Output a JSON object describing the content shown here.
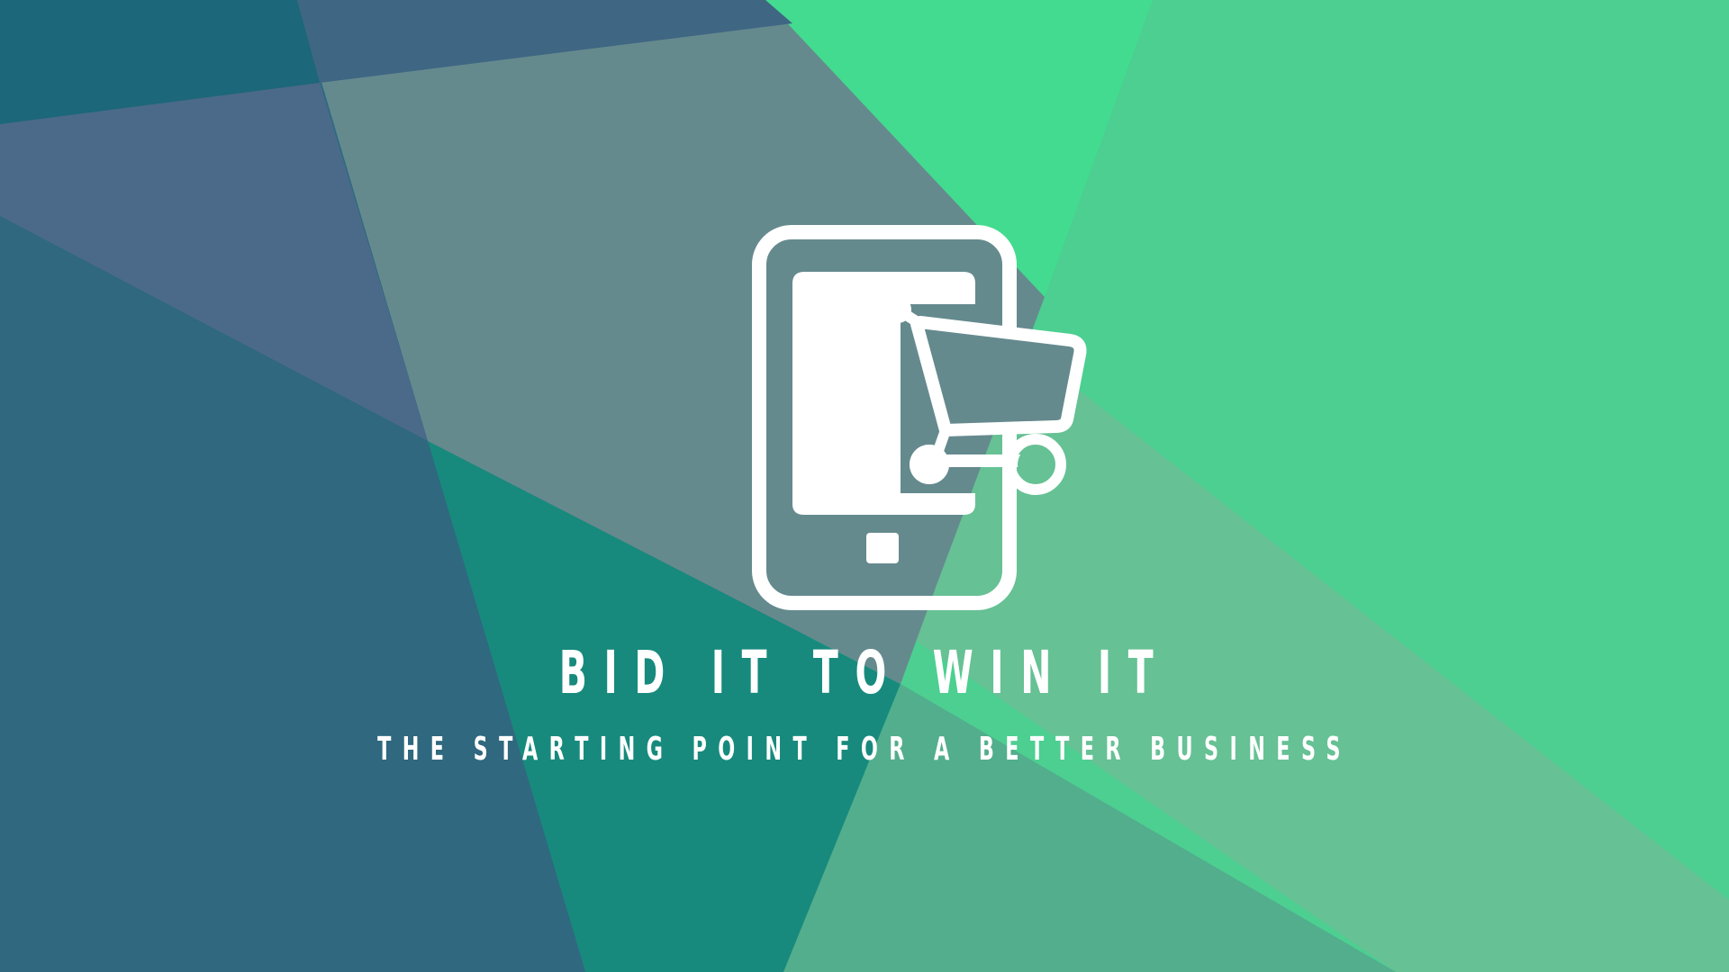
{
  "brand": {
    "title": "BID IT TO WIN IT",
    "tagline": "THE STARTING POINT FOR A BETTER BUSINESS",
    "logo_icon": "mobile-shopping-cart-icon"
  },
  "colors": {
    "dark_teal": "#2f6b80",
    "navy": "#4b6a8a",
    "teal": "#178a7d",
    "slate": "#658a8e",
    "mint": "#4ccf90",
    "bright_green": "#43db8f",
    "soft_green": "#66c194",
    "text": "#ffffff"
  }
}
